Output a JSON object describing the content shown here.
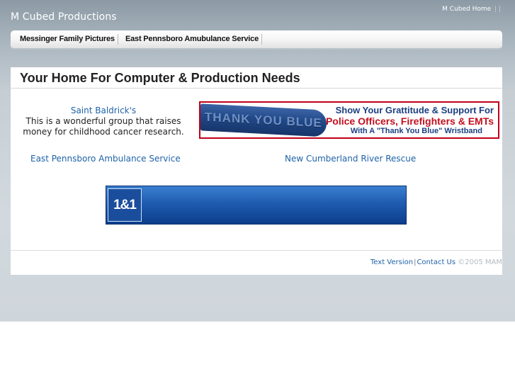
{
  "site": {
    "title": "M Cubed Productions"
  },
  "top_links": {
    "home": "M Cubed Home",
    "separator": "| |"
  },
  "nav": [
    {
      "label": "Messinger Family Pictures"
    },
    {
      "label": "East Pennsboro Amubulance Service"
    }
  ],
  "main": {
    "heading": "Your Home For Computer & Production Needs",
    "saint_baldricks": {
      "link": "Saint Baldrick's",
      "description": "This is a wonderful group that raises money for childhood cancer research."
    },
    "banner": {
      "wristband_text": "THANK YOU BLUE",
      "line1": "Show Your Grattitude & Support For",
      "line2": "Police Officers, Firefighters & EMTs",
      "line3": "With A \"Thank You Blue\" Wristband"
    },
    "links": {
      "east_pennsboro": "East Pennsboro Ambulance Service",
      "river_rescue": "New Cumberland River Rescue"
    },
    "ad": {
      "logo": "1&1"
    }
  },
  "footer": {
    "text_version": "Text Version",
    "separator": "|",
    "contact": "Contact Us",
    "copyright": "©2005 MAM"
  },
  "colors": {
    "link": "#1f62a8",
    "banner_red": "#c0001a",
    "banner_blue": "#1c3f80"
  }
}
